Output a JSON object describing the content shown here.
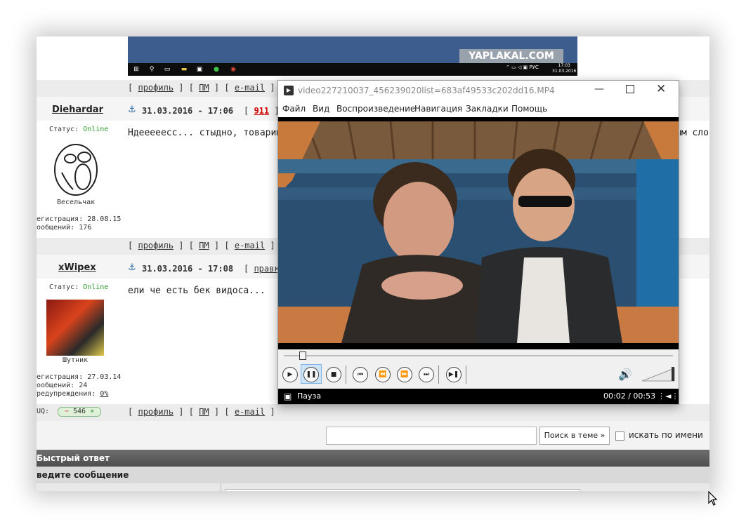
{
  "desktop": {
    "watermark": "YAPLAKAL.COM",
    "tray_text": "РУС",
    "clock_time": "17:03",
    "clock_date": "31.03.2016"
  },
  "post_links": {
    "open": "[",
    "close": "]",
    "profile": "профиль",
    "pm": "ПМ",
    "email": "e-mail"
  },
  "posts": [
    {
      "username": "Diehardar",
      "datetime": "31.03.2016 - 17:06",
      "number": "911",
      "status_label": "Статус:",
      "status_value": "Online",
      "avatar_caption": "Весельчак",
      "registration": "егистрация: 28.08.15",
      "messages": "ообщений: 176",
      "text": "Ндееееесс... стыдно, товарищи",
      "text_tail": "ым сло"
    },
    {
      "username": "xWipex",
      "datetime": "31.03.2016 - 17:08",
      "action": "правка",
      "status_label": "Статус:",
      "status_value": "Online",
      "avatar_caption": "Шутник",
      "registration": "егистрация: 27.03.14",
      "messages": "ообщений: 24",
      "warnings_label": "редупреждения:",
      "warnings_value": "0%",
      "uq_label": "UQ:",
      "uq_value": "546",
      "text": "ели че есть бек видоса..."
    }
  ],
  "search": {
    "button": "Поиск в теме »",
    "checkbox_label": "искать по имени"
  },
  "quick_reply": {
    "title": "Быстрый ответ",
    "enter_message": "ведите сообщение"
  },
  "player": {
    "title": "video227210037_456239020list=683af49533c202dd16.MP4",
    "menu": [
      "Файл",
      "Вид",
      "Воспроизведение",
      "Навигация",
      "Закладки",
      "Помощь"
    ],
    "progress": 0.04,
    "volume": 0.0,
    "status_text": "Пауза",
    "time": "00:02 / 00:53"
  },
  "colors": {
    "online": "#2e9b2e",
    "post_number": "#cc0000",
    "quick_reply_bar": "#5c5c5c"
  }
}
